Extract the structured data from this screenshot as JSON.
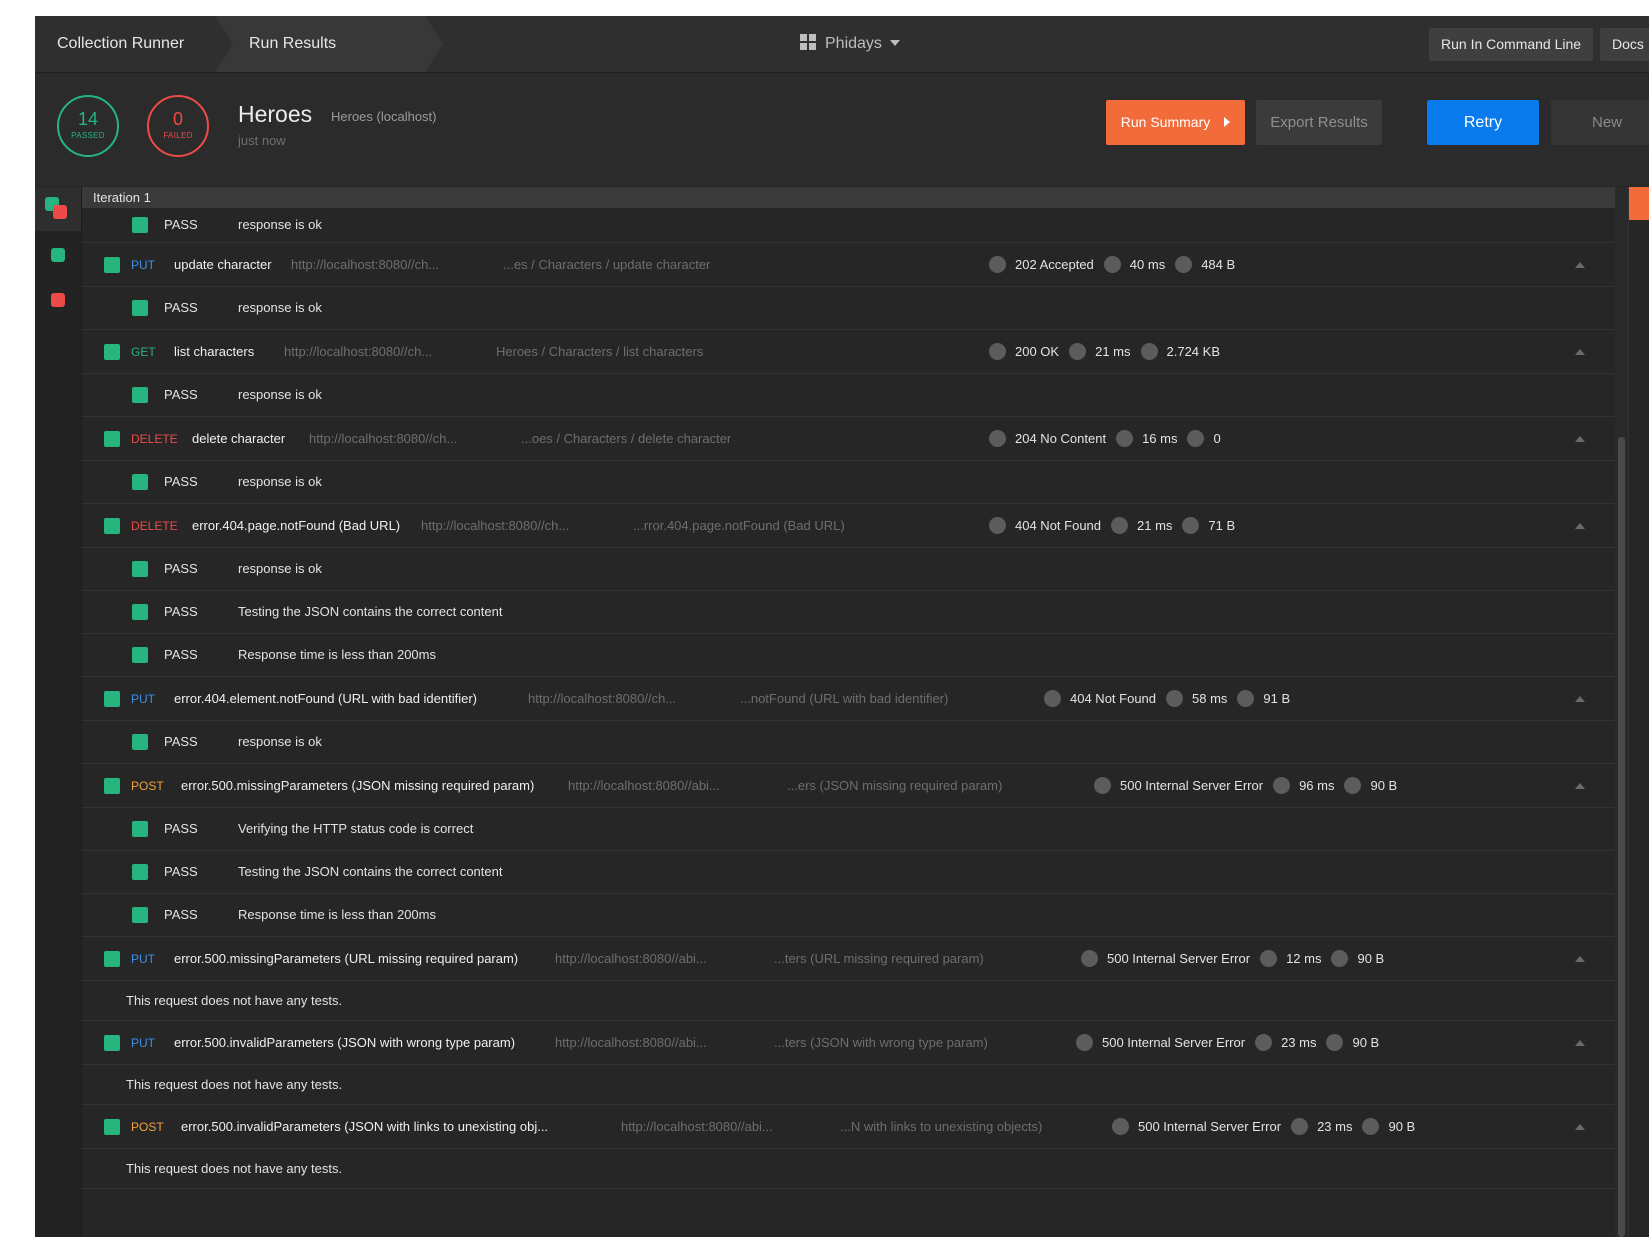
{
  "topbar": {
    "breadcrumb_runner": "Collection Runner",
    "breadcrumb_results": "Run Results",
    "workspace": "Phidays",
    "run_cli": "Run In Command Line",
    "docs": "Docs"
  },
  "summary": {
    "passed_count": "14",
    "passed_label": "PASSED",
    "failed_count": "0",
    "failed_label": "FAILED",
    "collection_name": "Heroes",
    "environment": "Heroes (localhost)",
    "time": "just now",
    "run_summary": "Run Summary",
    "export_results": "Export Results",
    "retry": "Retry",
    "new": "New"
  },
  "colors": {
    "pass": "#26b47f",
    "fail": "#ed4b48",
    "accent_orange": "#f26b3a",
    "accent_blue": "#097bed"
  },
  "iteration_label": "Iteration 1",
  "rows": [
    {
      "kind": "test",
      "status": "PASS",
      "name": "response is ok"
    },
    {
      "kind": "request",
      "method": "PUT",
      "name": "update character",
      "url": "http://localhost:8080//ch...",
      "path": "...es / Characters / update character",
      "status": "202 Accepted",
      "time": "40 ms",
      "size": "484 B"
    },
    {
      "kind": "test",
      "status": "PASS",
      "name": "response is ok"
    },
    {
      "kind": "request",
      "method": "GET",
      "name": "list characters",
      "url": "http://localhost:8080//ch...",
      "path": "Heroes / Characters / list characters",
      "status": "200 OK",
      "time": "21 ms",
      "size": "2.724 KB"
    },
    {
      "kind": "test",
      "status": "PASS",
      "name": "response is ok"
    },
    {
      "kind": "request",
      "method": "DELETE",
      "name": "delete character",
      "url": "http://localhost:8080//ch...",
      "path": "...oes / Characters / delete character",
      "status": "204 No Content",
      "time": "16 ms",
      "size": "0"
    },
    {
      "kind": "test",
      "status": "PASS",
      "name": "response is ok"
    },
    {
      "kind": "request",
      "method": "DELETE",
      "name": "error.404.page.notFound (Bad URL)",
      "url": "http://localhost:8080//ch...",
      "path": "...rror.404.page.notFound (Bad URL)",
      "status": "404 Not Found",
      "time": "21 ms",
      "size": "71 B"
    },
    {
      "kind": "test",
      "status": "PASS",
      "name": "response is ok"
    },
    {
      "kind": "test",
      "status": "PASS",
      "name": "Testing the JSON contains the correct content"
    },
    {
      "kind": "test",
      "status": "PASS",
      "name": "Response time is less than 200ms"
    },
    {
      "kind": "request",
      "method": "PUT",
      "name": "error.404.element.notFound (URL with bad identifier)",
      "url": "http://localhost:8080//ch...",
      "path": "...notFound (URL with bad identifier)",
      "status": "404 Not Found",
      "time": "58 ms",
      "size": "91 B"
    },
    {
      "kind": "test",
      "status": "PASS",
      "name": "response is ok"
    },
    {
      "kind": "request",
      "method": "POST",
      "name": "error.500.missingParameters (JSON missing required param)",
      "url": "http://localhost:8080//abi...",
      "path": "...ers (JSON missing required param)",
      "status": "500 Internal Server Error",
      "time": "96 ms",
      "size": "90 B"
    },
    {
      "kind": "test",
      "status": "PASS",
      "name": "Verifying the HTTP status code is correct"
    },
    {
      "kind": "test",
      "status": "PASS",
      "name": "Testing the JSON contains the correct content"
    },
    {
      "kind": "test",
      "status": "PASS",
      "name": "Response time is less than 200ms"
    },
    {
      "kind": "request",
      "method": "PUT",
      "name": "error.500.missingParameters (URL missing required param)",
      "url": "http://localhost:8080//abi...",
      "path": "...ters (URL missing required param)",
      "status": "500 Internal Server Error",
      "time": "12 ms",
      "size": "90 B"
    },
    {
      "kind": "notests",
      "text": "This request does not have any tests."
    },
    {
      "kind": "request",
      "method": "PUT",
      "name": "error.500.invalidParameters (JSON with wrong type param)",
      "url": "http://localhost:8080//abi...",
      "path": "...ters (JSON with wrong type param)",
      "status": "500 Internal Server Error",
      "time": "23 ms",
      "size": "90 B"
    },
    {
      "kind": "notests",
      "text": "This request does not have any tests."
    },
    {
      "kind": "request",
      "method": "POST",
      "name": "error.500.invalidParameters (JSON with links to unexisting obj...",
      "url": "http://localhost:8080//abi...",
      "path": "...N with links to unexisting objects)",
      "status": "500 Internal Server Error",
      "time": "23 ms",
      "size": "90 B"
    },
    {
      "kind": "notests",
      "text": "This request does not have any tests."
    }
  ]
}
